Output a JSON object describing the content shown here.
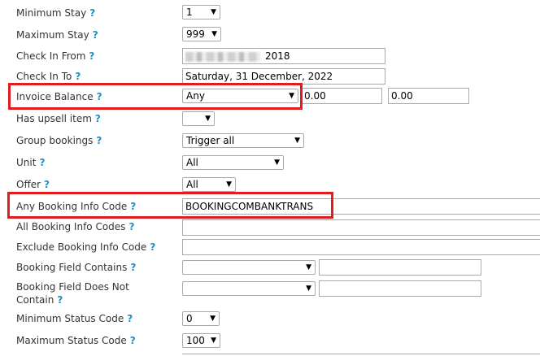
{
  "help_glyph": "?",
  "fields": {
    "minimum_stay": {
      "label": "Minimum Stay",
      "value": "1"
    },
    "maximum_stay": {
      "label": "Maximum Stay",
      "value": "999"
    },
    "check_in_from": {
      "label": "Check In From",
      "value": "2018"
    },
    "check_in_to": {
      "label": "Check In To",
      "value": "Saturday, 31 December, 2022"
    },
    "invoice_balance": {
      "label": "Invoice Balance",
      "value": "Any",
      "min": "0.00",
      "max": "0.00"
    },
    "has_upsell_item": {
      "label": "Has upsell item",
      "value": ""
    },
    "group_bookings": {
      "label": "Group bookings",
      "value": "Trigger all"
    },
    "unit": {
      "label": "Unit",
      "value": "All"
    },
    "offer": {
      "label": "Offer",
      "value": "All"
    },
    "any_booking_info_code": {
      "label": "Any Booking Info Code",
      "value": "BOOKINGCOMBANKTRANS"
    },
    "all_booking_info_codes": {
      "label": "All Booking Info Codes",
      "value": ""
    },
    "exclude_booking_info_code": {
      "label": "Exclude Booking Info Code",
      "value": ""
    },
    "booking_field_contains": {
      "label": "Booking Field Contains",
      "value": "",
      "text": ""
    },
    "booking_field_does_not_contain": {
      "label": "Booking Field Does Not Contain",
      "value": "",
      "text": ""
    },
    "minimum_status_code": {
      "label": "Minimum Status Code",
      "value": "0"
    },
    "maximum_status_code": {
      "label": "Maximum Status Code",
      "value": "100"
    }
  },
  "colors": {
    "highlight": "#e21c1c",
    "help": "#1f8fc7"
  }
}
